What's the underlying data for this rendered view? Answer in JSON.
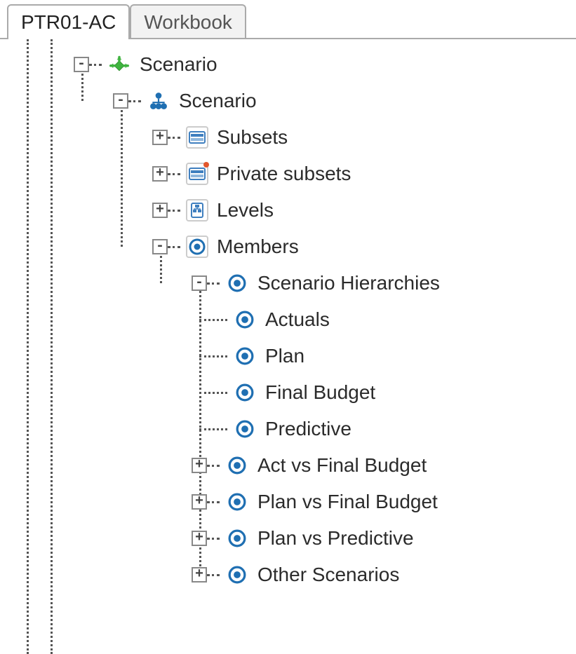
{
  "tabs": {
    "active": "PTR01-AC",
    "inactive": "Workbook"
  },
  "tree": {
    "root": {
      "label": "Scenario",
      "toggle": "-"
    },
    "dim": {
      "label": "Scenario",
      "toggle": "-"
    },
    "subsets": {
      "label": "Subsets",
      "toggle": "+"
    },
    "psubsets": {
      "label": "Private subsets",
      "toggle": "+"
    },
    "levels": {
      "label": "Levels",
      "toggle": "+"
    },
    "members": {
      "label": "Members",
      "toggle": "-"
    },
    "hier": {
      "label": "Scenario Hierarchies",
      "toggle": "-"
    },
    "m0": {
      "label": "Actuals"
    },
    "m1": {
      "label": "Plan"
    },
    "m2": {
      "label": "Final Budget"
    },
    "m3": {
      "label": "Predictive"
    },
    "m4": {
      "label": "Act vs Final Budget",
      "toggle": "+"
    },
    "m5": {
      "label": "Plan vs Final Budget",
      "toggle": "+"
    },
    "m6": {
      "label": "Plan vs Predictive",
      "toggle": "+"
    },
    "m7": {
      "label": "Other Scenarios",
      "toggle": "+"
    }
  },
  "glyph": {
    "plus": "+",
    "minus": "-"
  }
}
